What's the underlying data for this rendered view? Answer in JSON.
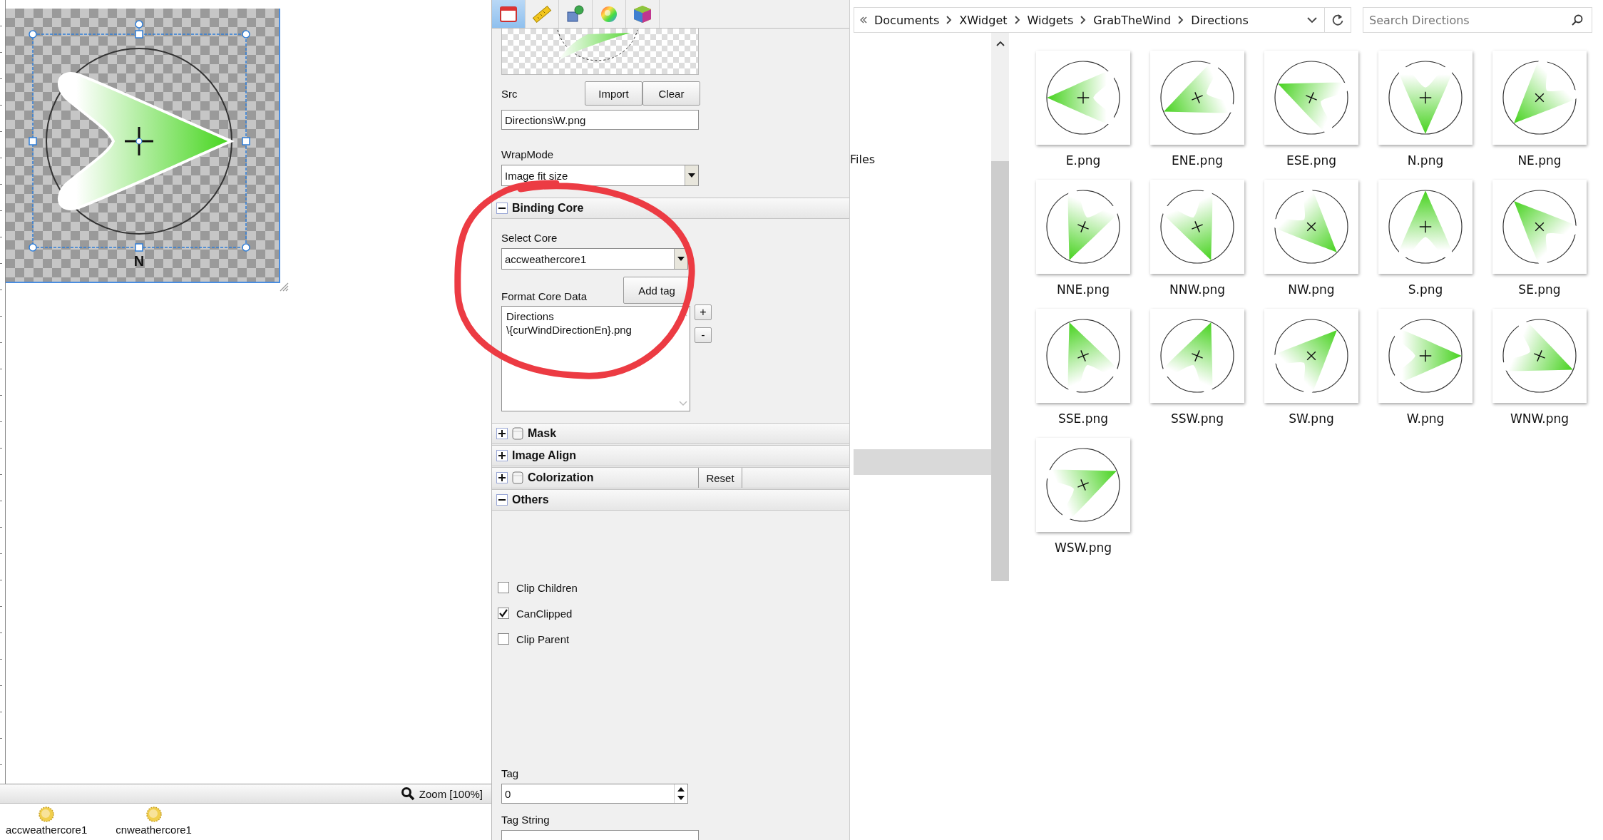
{
  "canvas": {
    "label": "N",
    "zoom": "Zoom [100%]",
    "cores": [
      {
        "name": "accweathercore1"
      },
      {
        "name": "cnweathercore1"
      }
    ]
  },
  "properties": {
    "tabs": [
      {
        "kind": "calendar",
        "selected": true
      },
      {
        "kind": "ruler",
        "selected": false
      },
      {
        "kind": "shapes",
        "selected": false
      },
      {
        "kind": "color-wheel",
        "selected": false
      },
      {
        "kind": "cube",
        "selected": false
      }
    ],
    "src_label": "Src",
    "buttons": [
      "Import",
      "Clear"
    ],
    "src_value": "Directions\\W.png",
    "wrap_label": "WrapMode",
    "wrap_value": "Image fit size",
    "binding_core": {
      "title": "Binding Core",
      "expanded": true,
      "select_label": "Select Core",
      "select_value": "accweathercore1",
      "format_label": "Format Core Data",
      "add_tag": "Add tag",
      "format_value": "Directions\n\\{curWindDirectionEn}.png",
      "plus": "+",
      "minus": "-"
    },
    "collapsed_sections": [
      {
        "title": "Mask",
        "enable_box": true,
        "expanded": false
      },
      {
        "title": "Image Align",
        "expanded": false
      },
      {
        "title": "Colorization",
        "enable_box": true,
        "expanded": false,
        "button": "Reset"
      }
    ],
    "others": {
      "title": "Others",
      "expanded": true,
      "checkboxes": [
        {
          "label": "Clip Children",
          "checked": false
        },
        {
          "label": "CanClipped",
          "checked": true
        },
        {
          "label": "Clip Parent",
          "checked": false
        }
      ],
      "tag_label": "Tag",
      "tag_value": "0",
      "tag_string_label": "Tag String"
    }
  },
  "explorer": {
    "breadcrumbs": [
      "Documents",
      "XWidget",
      "Widgets",
      "GrabTheWind",
      "Directions"
    ],
    "search_placeholder": "Search Directions",
    "nav_items": [
      {
        "label": "Files"
      }
    ],
    "files": [
      {
        "name": "E.png"
      },
      {
        "name": "ENE.png"
      },
      {
        "name": "ESE.png"
      },
      {
        "name": "N.png"
      },
      {
        "name": "NE.png"
      },
      {
        "name": "NNE.png"
      },
      {
        "name": "NNW.png"
      },
      {
        "name": "NW.png"
      },
      {
        "name": "S.png"
      },
      {
        "name": "SE.png"
      },
      {
        "name": "SSE.png"
      },
      {
        "name": "SSW.png"
      },
      {
        "name": "SW.png"
      },
      {
        "name": "W.png"
      },
      {
        "name": "WNW.png"
      },
      {
        "name": "WSW.png"
      }
    ]
  }
}
